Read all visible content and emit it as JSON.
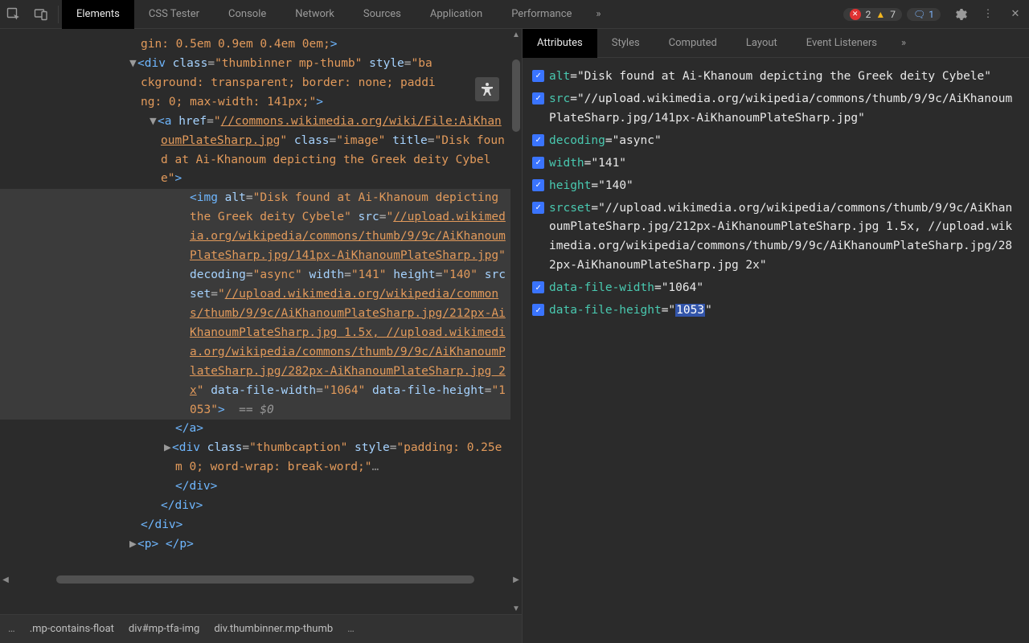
{
  "topbar": {
    "tabs": [
      "Elements",
      "CSS Tester",
      "Console",
      "Network",
      "Sources",
      "Application",
      "Performance"
    ],
    "active_tab": "Elements",
    "errors": "2",
    "warnings": "7",
    "issues": "1"
  },
  "dom": {
    "frag0": "gin: 0.5em 0.9em 0.4em 0em;",
    "div_open_pre": "div",
    "div_open_attr_class": "class",
    "div_open_val_class": "thumbinner mp-thumb",
    "div_open_attr_style": "style",
    "div_open_val_style": "background: transparent; border: none; padding: 0; max-width: 141px;",
    "a_tag": "a",
    "a_attr_href": "href",
    "a_val_href": "//commons.wikimedia.org/wiki/File:AiKhanoumPlateSharp.jpg",
    "a_attr_class": "class",
    "a_val_class": "image",
    "a_attr_title": "title",
    "a_val_title": "Disk found at Ai-Khanoum depicting the Greek deity Cybele",
    "img_tag": "img",
    "img_attr_alt": "alt",
    "img_val_alt": "Disk found at Ai-Khanoum depicting the Greek deity Cybele",
    "img_attr_src": "src",
    "img_val_src": "//upload.wikimedia.org/wikipedia/commons/thumb/9/9c/AiKhanoumPlateSharp.jpg/141px-AiKhanoumPlateSharp.jpg",
    "img_attr_decoding": "decoding",
    "img_val_decoding": "async",
    "img_attr_width": "width",
    "img_val_width": "141",
    "img_attr_height": "height",
    "img_val_height": "140",
    "img_attr_srcset": "srcset",
    "img_val_srcset1": "//upload.wikimedia.org/wikipedia/commons/thumb/9/9c/AiKhanoumPlateSharp.jpg/212px-AiKhanoumPlateSharp.jpg 1.5x, ",
    "img_val_srcset2": "//upload.wikimedia.org/wikipedia/commons/thumb/9/9c/AiKhanoumPlateSharp.jpg/282px-AiKhanoumPlateSharp.jpg 2x",
    "img_attr_dfw": "data-file-width",
    "img_val_dfw": "1064",
    "img_attr_dfh": "data-file-height",
    "img_val_dfh": "1053",
    "end0": "== $0",
    "close_a": "</a>",
    "cap_tag": "div",
    "cap_attr_class": "class",
    "cap_val_class": "thumbcaption",
    "cap_attr_style": "style",
    "cap_val_style": "padding: 0.25em 0; word-wrap: break-word;",
    "close_div": "</div>",
    "p_line": "<p> </p>"
  },
  "crumbs": {
    "leading": "…",
    "c1": ".mp-contains-float",
    "c2": "div#mp-tfa-img",
    "c3": "div.thumbinner.mp-thumb",
    "trailing": "…"
  },
  "subtabs": {
    "items": [
      "Attributes",
      "Styles",
      "Computed",
      "Layout",
      "Event Listeners"
    ],
    "active": "Attributes"
  },
  "attributes": [
    {
      "name": "alt",
      "value": "\"Disk found at Ai-Khanoum depicting the Greek deity Cybele\""
    },
    {
      "name": "src",
      "value": "\"//upload.wikimedia.org/wikipedia/commons/thumb/9/9c/AiKhanoumPlateSharp.jpg/141px-AiKhanoumPlateSharp.jpg\""
    },
    {
      "name": "decoding",
      "value": "\"async\""
    },
    {
      "name": "width",
      "value": "\"141\""
    },
    {
      "name": "height",
      "value": "\"140\""
    },
    {
      "name": "srcset",
      "value": "\"//upload.wikimedia.org/wikipedia/commons/thumb/9/9c/AiKhanoumPlateSharp.jpg/212px-AiKhanoumPlateSharp.jpg 1.5x, //upload.wikimedia.org/wikipedia/commons/thumb/9/9c/AiKhanoumPlateSharp.jpg/282px-AiKhanoumPlateSharp.jpg 2x\""
    },
    {
      "name": "data-file-width",
      "value": "\"1064\""
    },
    {
      "name": "data-file-height",
      "value": "\"",
      "sel": "1053",
      "tail": "\""
    }
  ]
}
